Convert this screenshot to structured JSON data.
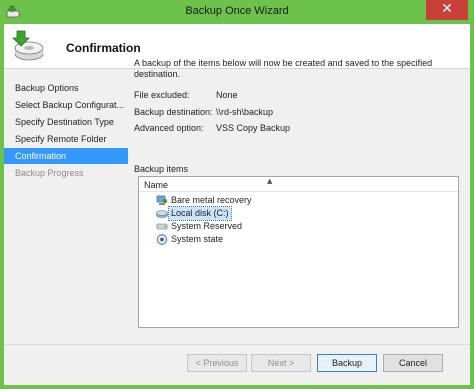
{
  "window": {
    "title": "Backup Once Wizard",
    "close_glyph": "✕"
  },
  "header": {
    "title": "Confirmation",
    "icon": "backup-wizard-icon"
  },
  "steps": [
    {
      "label": "Backup Options",
      "state": "normal"
    },
    {
      "label": "Select Backup Configurat...",
      "state": "normal"
    },
    {
      "label": "Specify Destination Type",
      "state": "normal"
    },
    {
      "label": "Specify Remote Folder",
      "state": "normal"
    },
    {
      "label": "Confirmation",
      "state": "active"
    },
    {
      "label": "Backup Progress",
      "state": "disabled"
    }
  ],
  "main": {
    "description": "A backup of the items below will now be created and saved to the specified destination.",
    "fields": [
      {
        "label": "File excluded:",
        "value": "None"
      },
      {
        "label": "Backup destination:",
        "value": "\\\\rd-sh\\backup"
      },
      {
        "label": "Advanced option:",
        "value": "VSS Copy Backup"
      }
    ],
    "items_label": "Backup items",
    "list": {
      "column_header": "Name",
      "items": [
        {
          "label": "Bare metal recovery",
          "icon": "bare-metal-recovery-icon"
        },
        {
          "label": "Local disk (C:)",
          "icon": "local-disk-icon",
          "selected": true
        },
        {
          "label": "System Reserved",
          "icon": "drive-icon"
        },
        {
          "label": "System state",
          "icon": "system-state-icon"
        }
      ]
    }
  },
  "buttons": {
    "previous": "< Previous",
    "next": "Next >",
    "backup": "Backup",
    "cancel": "Cancel"
  },
  "colors": {
    "titlebar": "#6cc24a",
    "selected_step": "#3399ff",
    "close_button": "#c7403a"
  }
}
